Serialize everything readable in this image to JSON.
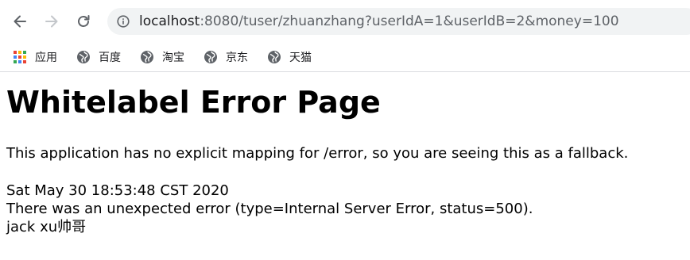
{
  "browser": {
    "url_host": "localhost",
    "url_rest": ":8080/tuser/zhuanzhang?userIdA=1&userIdB=2&money=100",
    "bookmarks": [
      {
        "label": "应用",
        "icon": "apps-grid-icon"
      },
      {
        "label": "百度",
        "icon": "globe-icon"
      },
      {
        "label": "淘宝",
        "icon": "globe-icon"
      },
      {
        "label": "京东",
        "icon": "globe-icon"
      },
      {
        "label": "天猫",
        "icon": "globe-icon"
      }
    ]
  },
  "page": {
    "title": "Whitelabel Error Page",
    "message": "This application has no explicit mapping for /error, so you are seeing this as a fallback.",
    "timestamp": "Sat May 30 18:53:48 CST 2020",
    "error_line": "There was an unexpected error (type=Internal Server Error, status=500).",
    "detail": "jack xu帅哥"
  },
  "colors": {
    "toolbar_icon": "#5f6368",
    "omnibox_bg": "#f1f3f4",
    "text": "#000000"
  }
}
